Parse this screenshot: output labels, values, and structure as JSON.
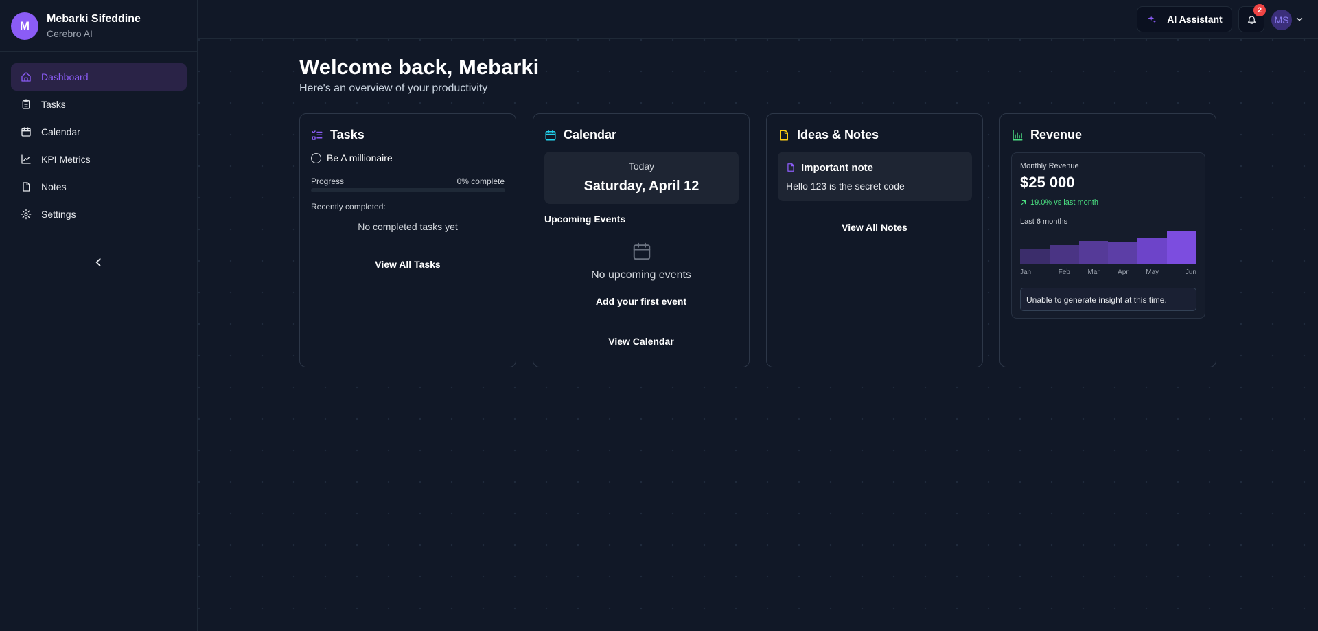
{
  "user": {
    "initial": "M",
    "name": "Mebarki Sifeddine",
    "org": "Cerebro AI",
    "avatar_initials": "MS"
  },
  "sidebar": {
    "items": [
      {
        "label": "Dashboard",
        "icon": "home-icon",
        "active": true
      },
      {
        "label": "Tasks",
        "icon": "clipboard-icon"
      },
      {
        "label": "Calendar",
        "icon": "calendar-icon"
      },
      {
        "label": "KPI Metrics",
        "icon": "chart-line-icon"
      },
      {
        "label": "Notes",
        "icon": "file-icon"
      },
      {
        "label": "Settings",
        "icon": "gear-icon"
      }
    ]
  },
  "topbar": {
    "ai_label": "AI Assistant",
    "notification_count": "2"
  },
  "header": {
    "title": "Welcome back, Mebarki",
    "subtitle": "Here's an overview of your productivity"
  },
  "tasks": {
    "title": "Tasks",
    "task": "Be A millionaire",
    "progress_label": "Progress",
    "progress_text": "0% complete",
    "progress_value": 0,
    "recent_label": "Recently completed:",
    "empty": "No completed tasks yet",
    "view_all": "View All Tasks"
  },
  "calendar": {
    "title": "Calendar",
    "today_label": "Today",
    "date": "Saturday, April 12",
    "upcoming_label": "Upcoming Events",
    "empty": "No upcoming events",
    "add_event": "Add your first event",
    "view_all": "View Calendar"
  },
  "notes": {
    "title": "Ideas & Notes",
    "note_title": "Important note",
    "note_body": "Hello 123 is the secret code",
    "view_all": "View All Notes"
  },
  "revenue": {
    "title": "Revenue",
    "label": "Monthly Revenue",
    "value": "$25 000",
    "change": "19.0% vs last month",
    "period": "Last 6 months",
    "insight": "Unable to generate insight at this time."
  },
  "colors": {
    "accent": "#8b5cf6",
    "cyan": "#22d3ee",
    "yellow": "#facc15",
    "green": "#4ade80",
    "danger": "#ef4444"
  },
  "chart_data": {
    "type": "bar",
    "categories": [
      "Jan",
      "Feb",
      "Mar",
      "Apr",
      "May",
      "Jun"
    ],
    "values": [
      48,
      58,
      71,
      68,
      81,
      100
    ],
    "colors": [
      "#3b2d6b",
      "#4a3484",
      "#553a98",
      "#5c3ea6",
      "#6d44c9",
      "#7c4ddf"
    ],
    "ylim": [
      0,
      100
    ]
  }
}
